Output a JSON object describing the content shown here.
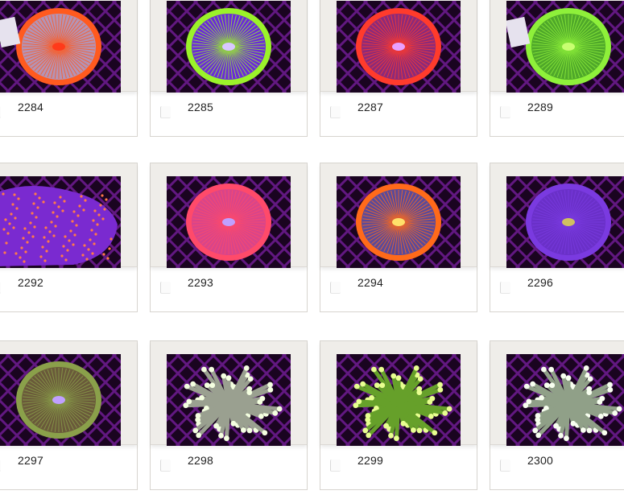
{
  "colors": {
    "card_frame": "#efede9",
    "card_border": "#d7d4cf",
    "label_text": "#222222",
    "photo_background": "#1a0420",
    "net_purple": "#7b1fa2"
  },
  "products": [
    {
      "id": "2284",
      "icon": "fungia-coral-photo",
      "rim": "#ff5a1f",
      "disc": "#b493b5",
      "center": "#ff3a1a",
      "tag": true
    },
    {
      "id": "2285",
      "icon": "fungia-coral-photo",
      "rim": "#9bf22a",
      "disc": "#6a2bd8",
      "center": "#d8c8ff",
      "tag": false
    },
    {
      "id": "2287",
      "icon": "fungia-coral-photo",
      "rim": "#ff3b2c",
      "disc": "#8c2a7a",
      "center": "#e9a0ff",
      "tag": false
    },
    {
      "id": "2289",
      "icon": "fungia-coral-photo",
      "rim": "#8ef03a",
      "disc": "#4fa82a",
      "center": "#c8ff70",
      "tag": true
    },
    {
      "id": "2292",
      "icon": "leather-coral-photo",
      "rim": "#8a3ae8",
      "disc": "#7a2ad0",
      "center": "#ff7a4a",
      "tag": false
    },
    {
      "id": "2293",
      "icon": "fungia-coral-photo",
      "rim": "#ff4a6a",
      "disc": "#d8458a",
      "center": "#c0a0ff",
      "tag": false
    },
    {
      "id": "2294",
      "icon": "fungia-coral-photo",
      "rim": "#ff6a1a",
      "disc": "#5a4a9a",
      "center": "#ffe06a",
      "tag": false
    },
    {
      "id": "2296",
      "icon": "fungia-coral-photo",
      "rim": "#7a3ae0",
      "disc": "#6a30c8",
      "center": "#d0c060",
      "tag": false
    },
    {
      "id": "2297",
      "icon": "fungia-coral-photo",
      "rim": "#8aa04a",
      "disc": "#6a5a3a",
      "center": "#c0a0ff",
      "tag": false
    },
    {
      "id": "2298",
      "icon": "torch-coral-photo",
      "rim": "#dfe8d0",
      "disc": "#9aa090",
      "center": "#f4ffe0",
      "tag": false
    },
    {
      "id": "2299",
      "icon": "torch-coral-photo",
      "rim": "#b8ff40",
      "disc": "#66a02a",
      "center": "#e8ff90",
      "tag": false
    },
    {
      "id": "2300",
      "icon": "torch-coral-photo",
      "rim": "#e0f0d8",
      "disc": "#90a088",
      "center": "#f8fff0",
      "tag": false
    }
  ]
}
